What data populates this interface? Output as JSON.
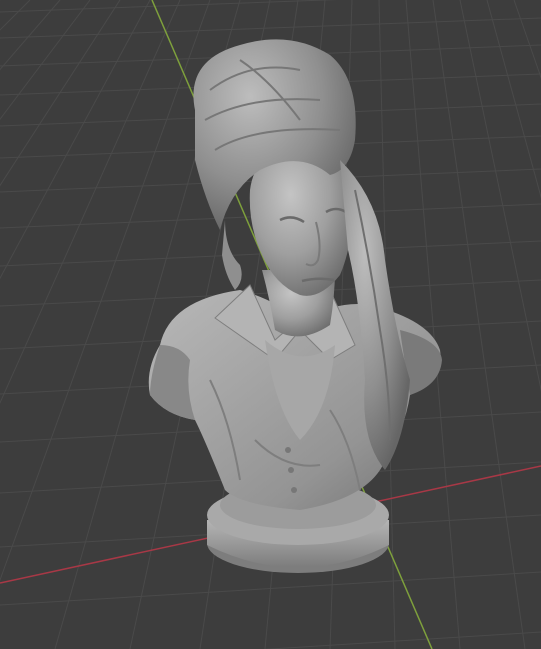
{
  "viewport": {
    "background_color": "#3d3d3d",
    "grid_line_color": "#4a4a4a",
    "grid_line_minor_color": "#454545",
    "x_axis_color": "#a83846",
    "y_axis_color": "#7ea03c",
    "model_color": "#9a9a9a",
    "model_name": "sculpted-bust"
  }
}
